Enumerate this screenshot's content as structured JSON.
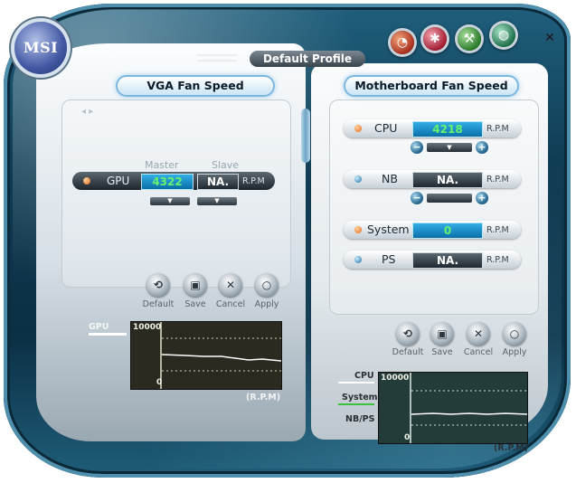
{
  "app": {
    "logo": "MSI",
    "profile": "Default Profile"
  },
  "top_icons": [
    {
      "name": "gauge-icon",
      "glyph": "◔",
      "color": "#d44a2c"
    },
    {
      "name": "fan-icon",
      "glyph": "✱",
      "color": "#c0213a"
    },
    {
      "name": "tools-icon",
      "glyph": "⚒",
      "color": "#3c8b3a"
    },
    {
      "name": "globe-icon",
      "glyph": "◍",
      "color": "#2d7b59"
    }
  ],
  "close_glyph": "✕",
  "vga": {
    "header": "VGA Fan Speed",
    "deco": "◂ ▸",
    "col_master": "Master",
    "col_slave": "Slave",
    "row_label": "GPU",
    "master_value": "4322",
    "slave_value": "NA.",
    "unit": "R.P.M",
    "dropdown_glyph": "▼"
  },
  "motherboard": {
    "header": "Motherboard Fan Speed",
    "rows": [
      {
        "label": "CPU",
        "value": "4218",
        "unit": "R.P.M",
        "dot": "orange"
      },
      {
        "label": "NB",
        "value": "NA.",
        "unit": "R.P.M",
        "dot": "blue"
      },
      {
        "label": "System",
        "value": "0",
        "unit": "R.P.M",
        "dot": "orange"
      },
      {
        "label": "PS",
        "value": "NA.",
        "unit": "R.P.M",
        "dot": "blue"
      }
    ],
    "minus": "−",
    "plus": "+",
    "bar_glyph": "▼"
  },
  "actions": {
    "default": "Default",
    "save": "Save",
    "cancel": "Cancel",
    "apply": "Apply"
  },
  "vga_graph": {
    "side_label": "GPU",
    "top": "10000",
    "bottom": "0",
    "unit": "(R.P.M)"
  },
  "mobo_graph": {
    "side_labels": [
      "CPU",
      "System",
      "NB/PS"
    ],
    "top": "10000",
    "bottom": "0",
    "unit": "(R.P.M)"
  },
  "colors": {
    "accent": "#1a8fd0",
    "skin": "#0f3b52",
    "value_green": "#67f26d"
  }
}
